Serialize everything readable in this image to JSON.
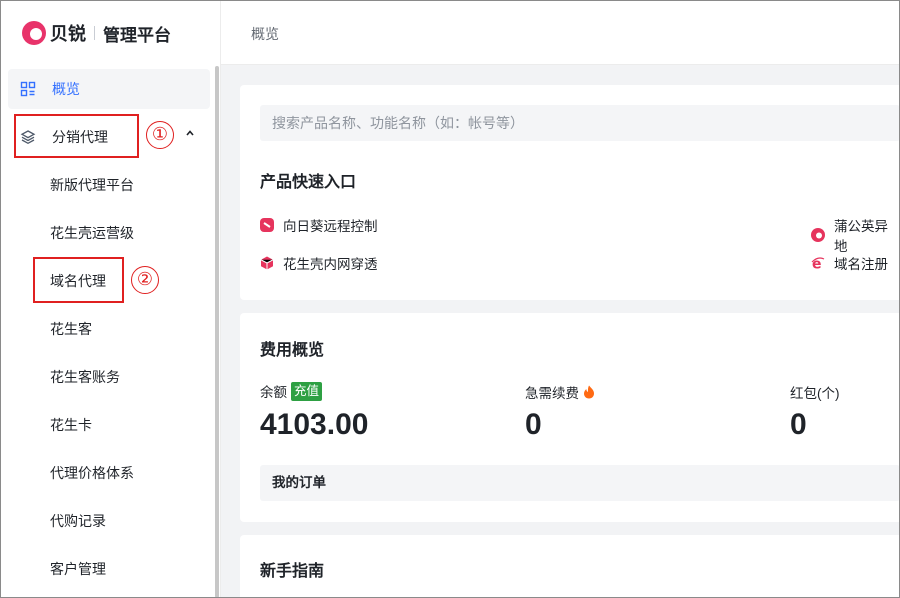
{
  "app": {
    "brand": "贝锐",
    "subtitle": "管理平台",
    "brand_color": "#e8336a"
  },
  "sidebar": {
    "overview": "概览",
    "group": "分销代理",
    "sub_items": [
      "新版代理平台",
      "花生壳运营级",
      "域名代理",
      "花生客",
      "花生客账务",
      "花生卡",
      "代理价格体系",
      "代购记录",
      "客户管理"
    ]
  },
  "annotations": {
    "one": "①",
    "two": "②"
  },
  "header": {
    "breadcrumb": "概览"
  },
  "search": {
    "placeholder": "搜索产品名称、功能名称（如：帐号等）"
  },
  "quick_entry": {
    "title": "产品快速入口",
    "items": [
      {
        "label": "向日葵远程控制",
        "icon": "sunflower-icon"
      },
      {
        "label": "蒲公英异地",
        "icon": "pgy-icon"
      },
      {
        "label": "花生壳内网穿透",
        "icon": "cube-icon"
      },
      {
        "label": "域名注册",
        "icon": "ie-icon"
      }
    ]
  },
  "fees": {
    "title": "费用概览",
    "balance_label": "余额",
    "recharge": "充值",
    "balance_value": "4103.00",
    "renewal_label": "急需续费",
    "renewal_value": "0",
    "redpacket_label": "红包(个)",
    "redpacket_value": "0",
    "orders": "我的订单"
  },
  "guide": {
    "title": "新手指南"
  },
  "colors": {
    "accent": "#3370ff",
    "annotation": "#e02020",
    "badge": "#2ea043"
  }
}
